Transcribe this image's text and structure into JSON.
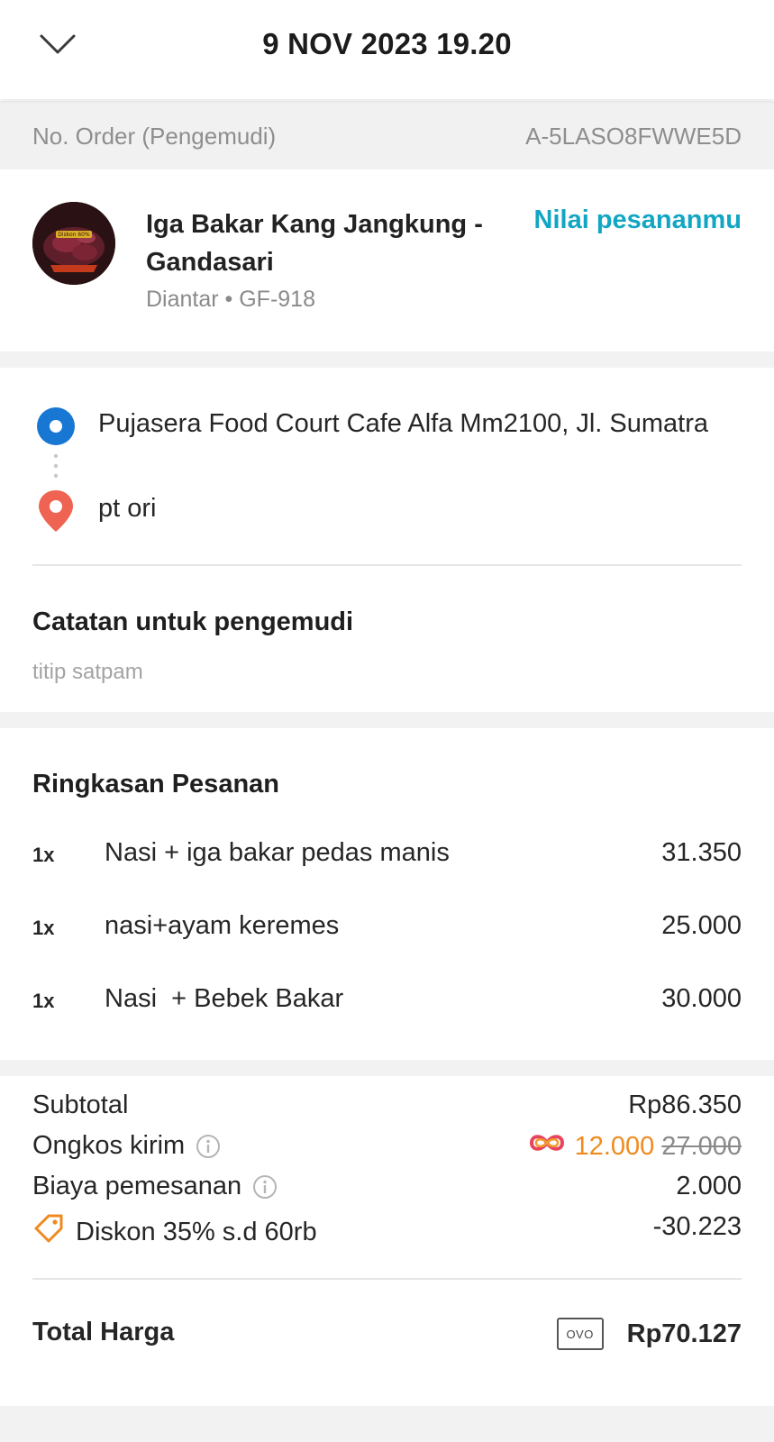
{
  "header": {
    "title": "9 NOV 2023 19.20",
    "back_icon": "chevron-down-icon"
  },
  "order": {
    "label": "No. Order (Pengemudi)",
    "value": "A-5LASO8FWWE5D"
  },
  "merchant": {
    "name": "Iga Bakar Kang Jangkung - Gandasari",
    "subtitle": "Diantar • GF-918",
    "rate_link": "Nilai pesananmu",
    "avatar_text": "Diskon 60%"
  },
  "route": {
    "origin": "Pujasera Food Court Cafe Alfa Mm2100, Jl. Sumatra",
    "destination": "pt ori",
    "origin_color": "#1877d2",
    "destination_color": "#ee6352"
  },
  "note": {
    "title": "Catatan untuk pengemudi",
    "text": "titip satpam"
  },
  "summary": {
    "title": "Ringkasan Pesanan",
    "items": [
      {
        "qty": "1x",
        "name": "Nasi + iga bakar pedas manis",
        "price": "31.350"
      },
      {
        "qty": "1x",
        "name": "nasi+ayam keremes",
        "price": "25.000"
      },
      {
        "qty": "1x",
        "name": "Nasi  + Bebek Bakar",
        "price": "30.000"
      }
    ]
  },
  "totals": {
    "subtotal_label": "Subtotal",
    "subtotal_value": "Rp86.350",
    "delivery_label": "Ongkos kirim",
    "delivery_value": "12.000",
    "delivery_original": "27.000",
    "fee_label": "Biaya pemesanan",
    "fee_value": "2.000",
    "discount_label": "Diskon 35% s.d 60rb",
    "discount_value": "-30.223",
    "total_label": "Total Harga",
    "total_value": "Rp70.127",
    "payment_method": "OVO",
    "accent_orange": "#f08a1e",
    "accent_green": "#17a35a"
  }
}
